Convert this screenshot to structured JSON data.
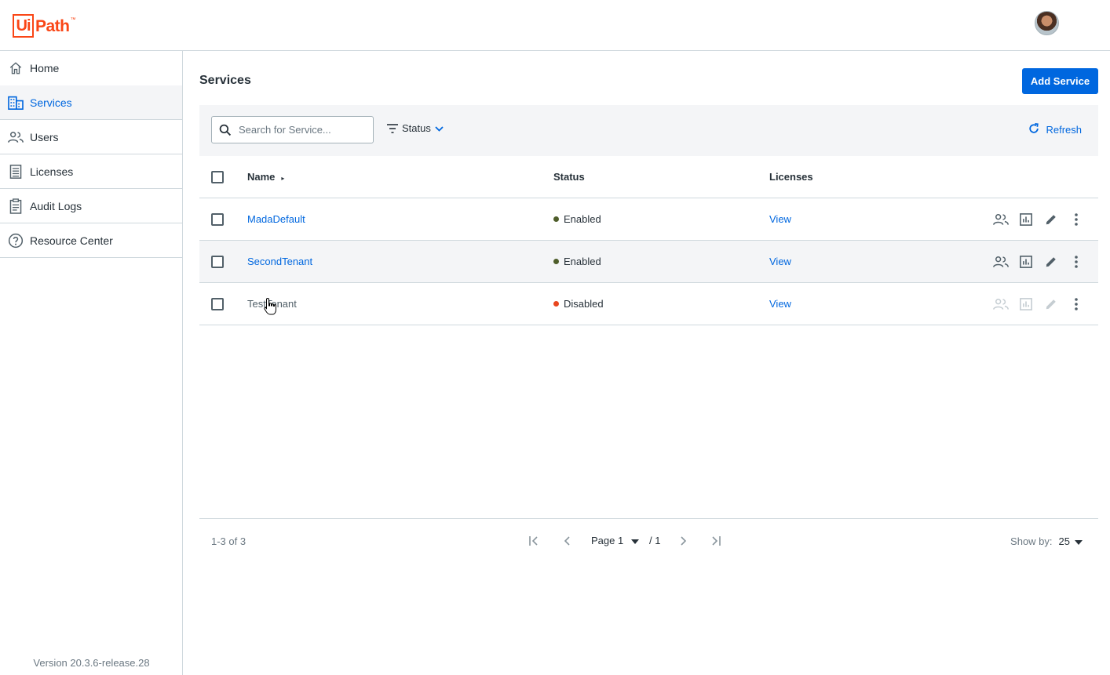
{
  "header": {
    "logo_box": "Ui",
    "logo_text": "Path",
    "logo_tm": "™"
  },
  "sidebar": {
    "items": [
      {
        "label": "Home",
        "icon": "home-icon"
      },
      {
        "label": "Services",
        "icon": "services-icon",
        "active": true
      },
      {
        "label": "Users",
        "icon": "users-icon"
      },
      {
        "label": "Licenses",
        "icon": "licenses-icon"
      },
      {
        "label": "Audit Logs",
        "icon": "audit-logs-icon"
      },
      {
        "label": "Resource Center",
        "icon": "help-icon"
      }
    ],
    "version": "Version 20.3.6-release.28"
  },
  "main": {
    "title": "Services",
    "add_button": "Add Service",
    "search_placeholder": "Search for Service...",
    "status_filter": "Status",
    "refresh": "Refresh",
    "columns": {
      "name": "Name",
      "status": "Status",
      "licenses": "Licenses"
    },
    "rows": [
      {
        "name": "MadaDefault",
        "status": "Enabled",
        "licenses": "View"
      },
      {
        "name": "SecondTenant",
        "status": "Enabled",
        "licenses": "View"
      },
      {
        "name": "TestTenant",
        "status": "Disabled",
        "licenses": "View"
      }
    ],
    "pagination": {
      "range": "1-3 of 3",
      "page_label": "Page 1",
      "page_total": "/ 1",
      "show_by_label": "Show by:",
      "show_by_value": "25"
    }
  },
  "colors": {
    "accent": "#0067df",
    "brand": "#fa4616",
    "enabled": "#4e5d2a",
    "disabled": "#e8461e"
  }
}
